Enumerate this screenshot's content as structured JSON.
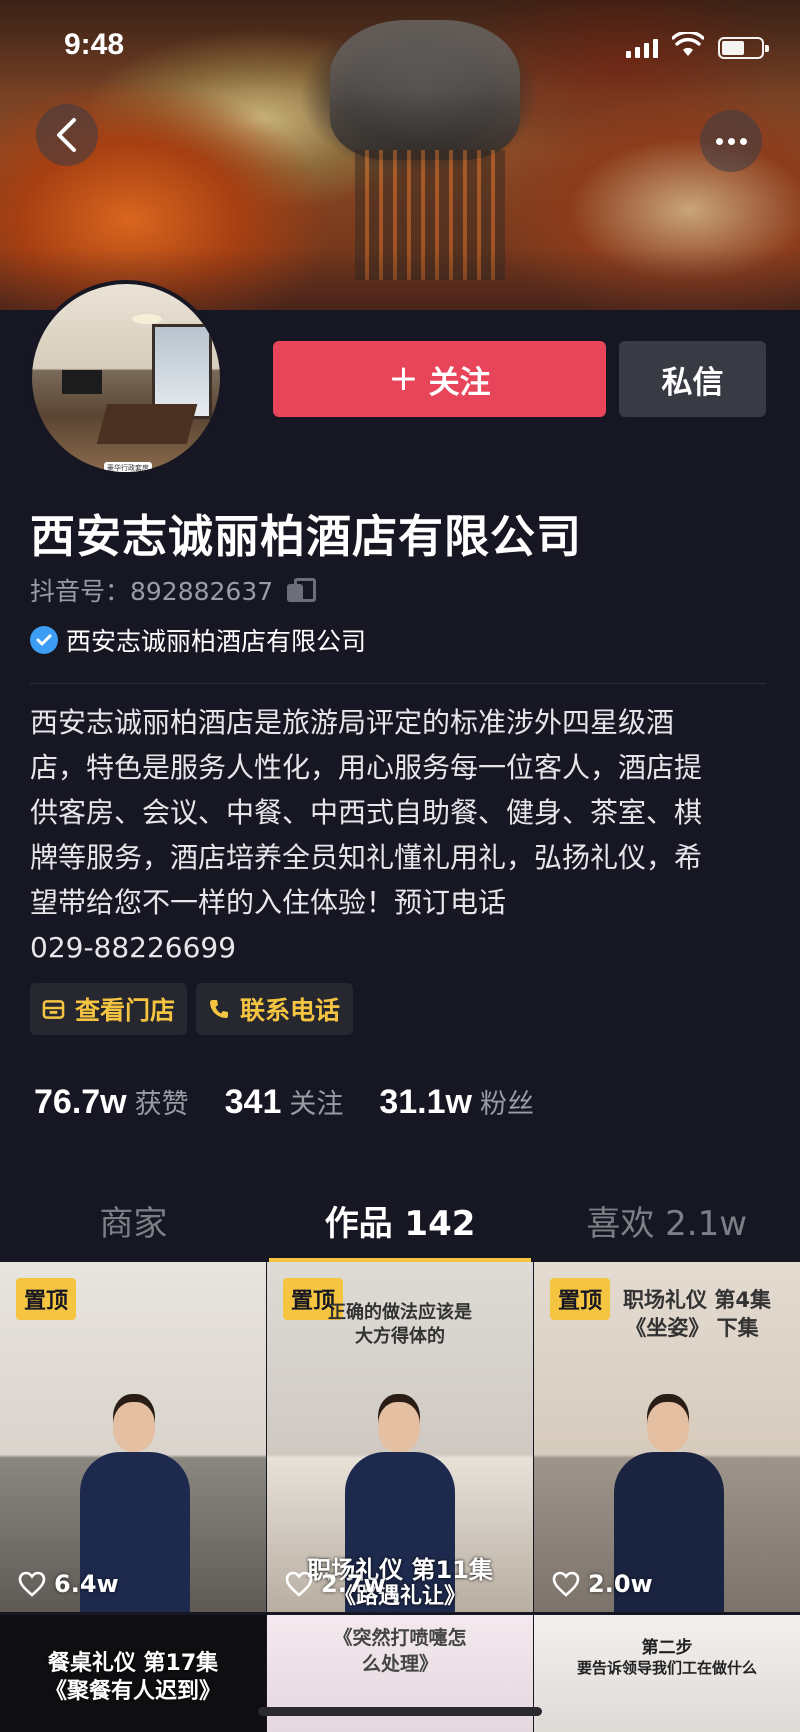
{
  "status_bar": {
    "time": "9:48"
  },
  "profile": {
    "name": "西安志诚丽柏酒店有限公司",
    "douyin_id": "抖音号：892882637",
    "verified_label": "西安志诚丽柏酒店有限公司",
    "avatar_tag": "豪华行政套房",
    "follow_label": "关注",
    "message_label": "私信",
    "bio_lines": [
      "西安志诚丽柏酒店是旅游局评定的标准涉外四星级酒",
      "店，特色是服务人性化，用心服务每一位客人，酒店提",
      "供客房、会议、中餐、中西式自助餐、健身、茶室、棋",
      "牌等服务，酒店培养全员知礼懂礼用礼，弘扬礼仪，希",
      "望带给您不一样的入住体验！预订电话",
      "029-88226699"
    ],
    "chips": {
      "store": "查看门店",
      "phone": "联系电话"
    },
    "stats": [
      {
        "num": "76.7w",
        "label": "获赞"
      },
      {
        "num": "341",
        "label": "关注"
      },
      {
        "num": "31.1w",
        "label": "粉丝"
      }
    ]
  },
  "tabs": [
    {
      "label": "商家",
      "active": false
    },
    {
      "label": "作品 142",
      "active": true
    },
    {
      "label": "喜欢 2.1w",
      "active": false
    }
  ],
  "videos": [
    {
      "pin": "置顶",
      "likes": "6.4w",
      "caption_top": "",
      "caption_bottom_1": "",
      "caption_bottom_2": ""
    },
    {
      "pin": "置顶",
      "likes": "2.7w",
      "caption_top_1": "正确的做法应该是",
      "caption_top_2": "大方得体的",
      "caption_bottom_1": "职场礼仪 第11集",
      "caption_bottom_2": "《路遇礼让》"
    },
    {
      "pin": "置顶",
      "likes": "2.0w",
      "caption_top_1": "职场礼仪 第4集",
      "caption_top_2": "《坐姿》 下集"
    },
    {
      "caption_1": "餐桌礼仪 第17集",
      "caption_2": "《聚餐有人迟到》"
    },
    {
      "caption_1": "《突然打喷嚏怎",
      "caption_2": "么处理》"
    },
    {
      "caption_1": "第二步",
      "caption_2": "要告诉领导我们工在做什么"
    }
  ],
  "colors": {
    "background": "#161722",
    "follow": "#e8445a",
    "accent": "#f5c542",
    "verified": "#3d9df5"
  }
}
